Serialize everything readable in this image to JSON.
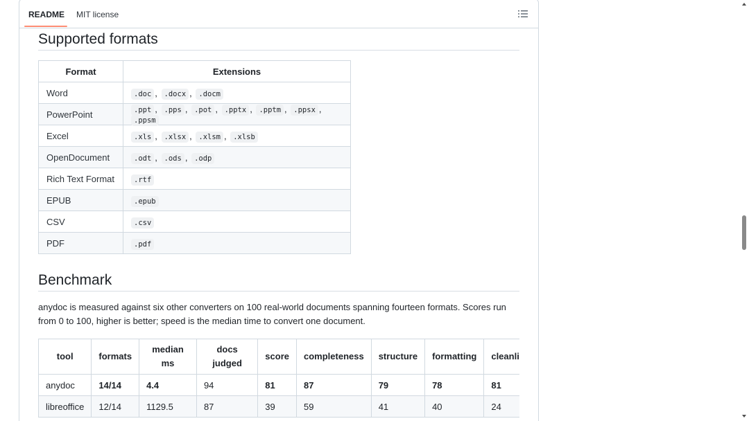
{
  "tabs": [
    {
      "label": "README",
      "active": true
    },
    {
      "label": "MIT license",
      "active": false
    }
  ],
  "icons": {
    "outline": "list-outline-icon"
  },
  "accent_color": "#fd8c73",
  "sections": {
    "formats": {
      "title": "Supported formats",
      "columns": [
        "Format",
        "Extensions"
      ],
      "rows": [
        {
          "name": "Word",
          "ext": [
            ".doc",
            ".docx",
            ".docm"
          ]
        },
        {
          "name": "PowerPoint",
          "ext": [
            ".ppt",
            ".pps",
            ".pot",
            ".pptx",
            ".pptm",
            ".ppsx",
            ".ppsm"
          ]
        },
        {
          "name": "Excel",
          "ext": [
            ".xls",
            ".xlsx",
            ".xlsm",
            ".xlsb"
          ]
        },
        {
          "name": "OpenDocument",
          "ext": [
            ".odt",
            ".ods",
            ".odp"
          ]
        },
        {
          "name": "Rich Text Format",
          "ext": [
            ".rtf"
          ]
        },
        {
          "name": "EPUB",
          "ext": [
            ".epub"
          ]
        },
        {
          "name": "CSV",
          "ext": [
            ".csv"
          ]
        },
        {
          "name": "PDF",
          "ext": [
            ".pdf"
          ]
        }
      ]
    },
    "benchmark": {
      "title": "Benchmark",
      "description": "anydoc is measured against six other converters on 100 real-world documents spanning fourteen formats. Scores run from 0 to 100, higher is better; speed is the median time to convert one document.",
      "columns": [
        "tool",
        "formats",
        "median ms",
        "docs judged",
        "score",
        "completeness",
        "structure",
        "formatting",
        "cleanline"
      ],
      "rows": [
        {
          "cells": [
            "anydoc",
            "14/14",
            "4.4",
            "94",
            "81",
            "87",
            "79",
            "78",
            "81"
          ],
          "bold": [
            false,
            true,
            true,
            false,
            true,
            true,
            true,
            true,
            true
          ]
        },
        {
          "cells": [
            "libreoffice",
            "12/14",
            "1129.5",
            "87",
            "39",
            "59",
            "41",
            "40",
            "24"
          ],
          "bold": [
            false,
            false,
            false,
            false,
            false,
            false,
            false,
            false,
            false
          ]
        }
      ]
    }
  }
}
